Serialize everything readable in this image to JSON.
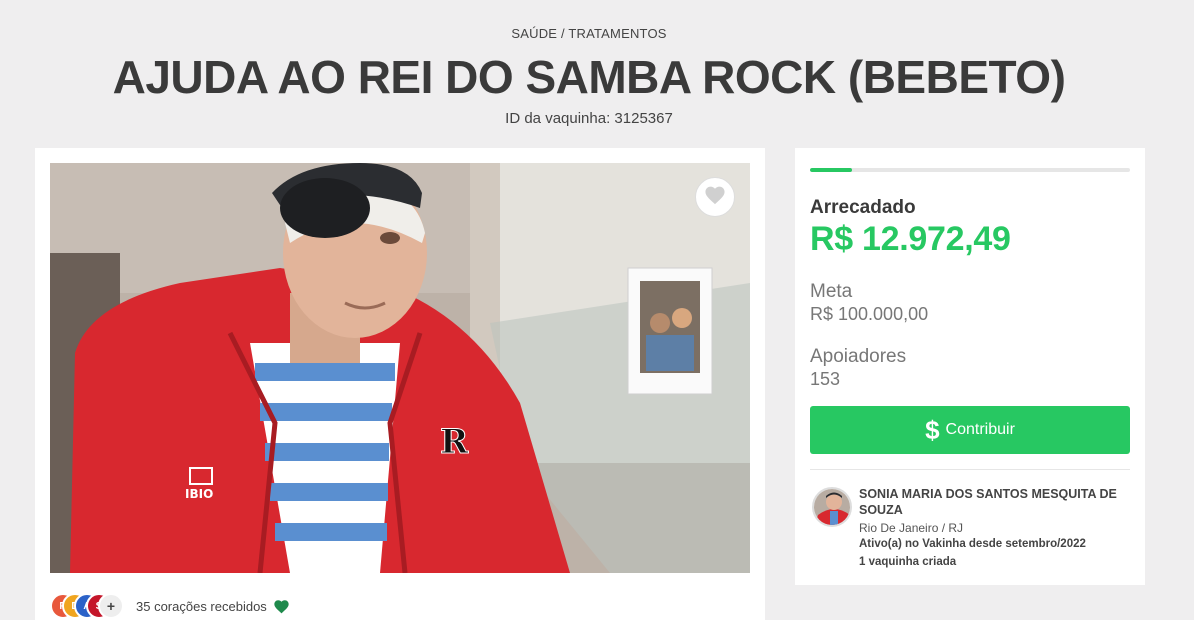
{
  "header": {
    "category": "SAÚDE / TRATAMENTOS",
    "title": "AJUDA AO REI DO SAMBA ROCK (BEBETO)",
    "campaign_id": "ID da vaquinha: 3125367"
  },
  "photo": {
    "favorite_icon": "heart-icon"
  },
  "hearts": {
    "avatars": [
      "R",
      "D",
      "A",
      "S"
    ],
    "avatar_colors": [
      "#e8583c",
      "#f0a51f",
      "#2b62c8",
      "#c4162a"
    ],
    "more_label": "+",
    "text": "35 corações recebidos",
    "heart_color": "#1f8a4c"
  },
  "stats": {
    "progress_fraction": 0.13,
    "raised_label": "Arrecadado",
    "raised_value": "R$ 12.972,49",
    "goal_label": "Meta",
    "goal_value": "R$ 100.000,00",
    "supporters_label": "Apoiadores",
    "supporters_value": "153",
    "contribute_icon": "dollar-icon",
    "contribute_label": "Contribuir",
    "accent": "#27c862"
  },
  "creator": {
    "name": "SONIA MARIA DOS SANTOS MESQUITA DE SOUZA",
    "location": "Rio De Janeiro /  RJ",
    "active_since": "Ativo(a) no Vakinha desde setembro/2022",
    "campaigns": "1 vaquinha criada"
  }
}
